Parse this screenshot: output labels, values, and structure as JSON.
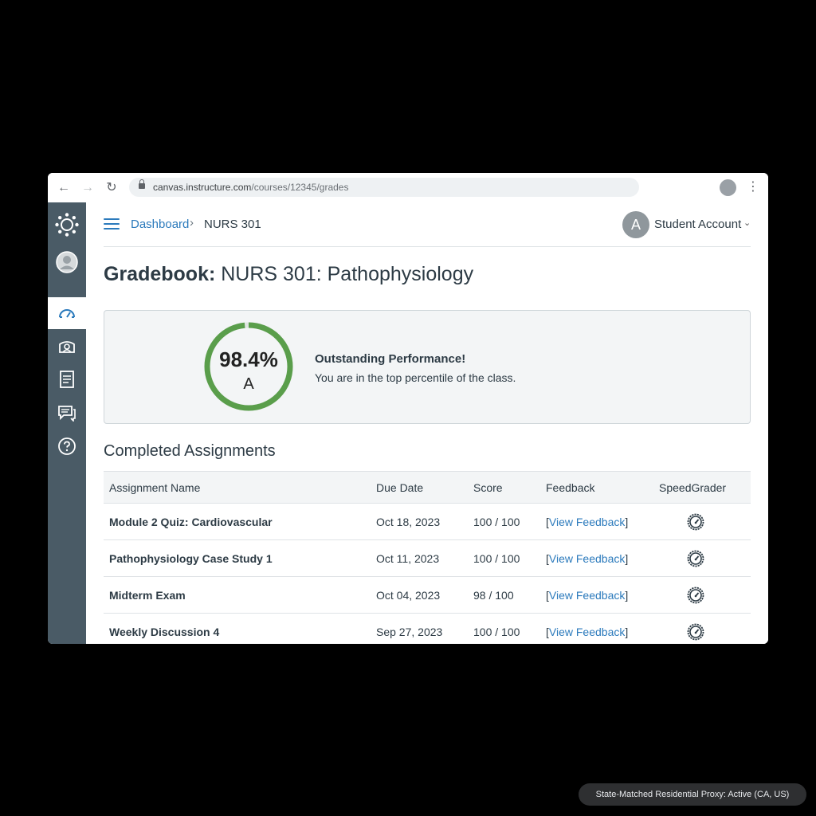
{
  "browser": {
    "url_domain": "canvas.instructure.com",
    "url_path": "/courses/12345/grades"
  },
  "header": {
    "breadcrumb_link": "Dashboard",
    "breadcrumb_separator": "›",
    "breadcrumb_current": "NURS 301",
    "avatar_initial": "A",
    "account_name": "Student Account"
  },
  "page": {
    "title_prefix": "Gradebook:",
    "title_course": "NURS 301: Pathophysiology"
  },
  "summary": {
    "percent_text": "98.4%",
    "percent_value": 98.4,
    "letter_grade": "A",
    "headline": "Outstanding Performance!",
    "message": "You are in the top percentile of the class.",
    "ring_color": "#5a9e4b"
  },
  "assignments": {
    "section_title": "Completed Assignments",
    "columns": [
      "Assignment Name",
      "Due Date",
      "Score",
      "Feedback",
      "SpeedGrader"
    ],
    "rows": [
      {
        "name": "Module 2 Quiz: Cardiovascular",
        "due": "Oct 18, 2023",
        "score": "100 / 100",
        "feedback": "View Feedback"
      },
      {
        "name": "Pathophysiology Case Study 1",
        "due": "Oct 11, 2023",
        "score": "100 / 100",
        "feedback": "View Feedback"
      },
      {
        "name": "Midterm Exam",
        "due": "Oct 04, 2023",
        "score": "98 / 100",
        "feedback": "View Feedback"
      },
      {
        "name": "Weekly Discussion 4",
        "due": "Sep 27, 2023",
        "score": "100 / 100",
        "feedback": "View Feedback"
      }
    ]
  },
  "sidebar": {
    "items": [
      "canvas-logo-icon",
      "account-icon",
      "dashboard-icon",
      "courses-icon",
      "calendar-icon",
      "inbox-icon",
      "help-icon"
    ]
  },
  "status_toast": "State-Matched Residential Proxy: Active (CA, US)",
  "colors": {
    "link": "#2b7abc",
    "sidebar": "#4a5b66",
    "success": "#5a9e4b"
  }
}
